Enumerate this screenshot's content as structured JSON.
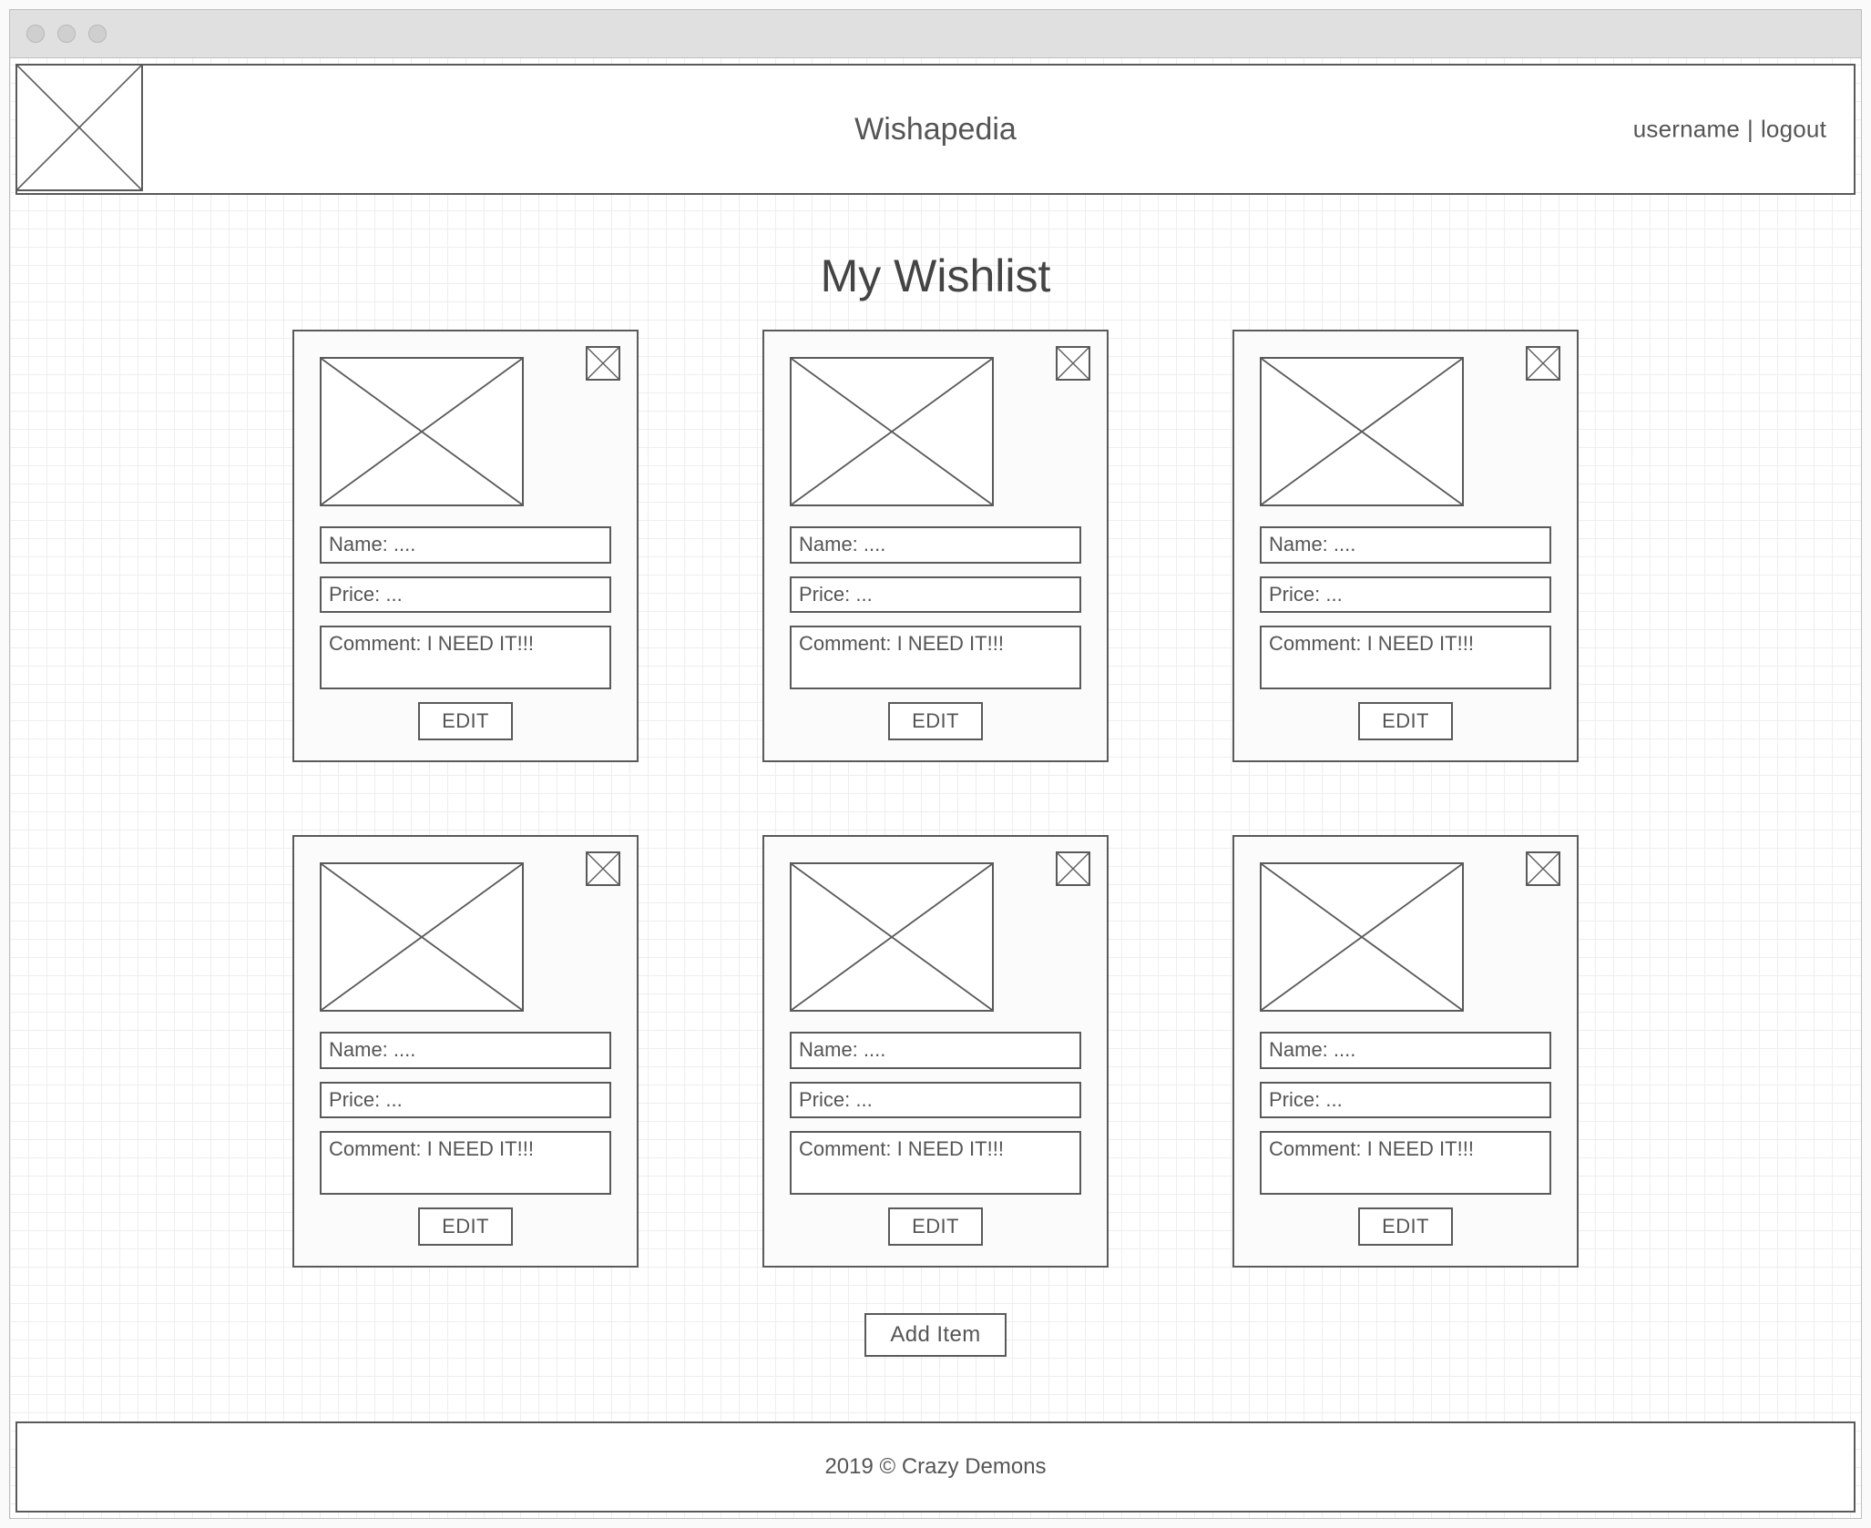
{
  "header": {
    "site_title": "Wishapedia",
    "user": {
      "name": "username",
      "logout": "logout",
      "sep": "|"
    }
  },
  "page": {
    "title": "My Wishlist",
    "add_button": "Add Item",
    "edit_button": "EDIT"
  },
  "items": [
    {
      "name": "Name: ....",
      "price": "Price: ...",
      "comment": "Comment: I NEED IT!!!"
    },
    {
      "name": "Name: ....",
      "price": "Price: ...",
      "comment": "Comment: I NEED IT!!!"
    },
    {
      "name": "Name: ....",
      "price": "Price: ...",
      "comment": "Comment: I NEED IT!!!"
    },
    {
      "name": "Name: ....",
      "price": "Price: ...",
      "comment": "Comment: I NEED IT!!!"
    },
    {
      "name": "Name: ....",
      "price": "Price: ...",
      "comment": "Comment: I NEED IT!!!"
    },
    {
      "name": "Name: ....",
      "price": "Price: ...",
      "comment": "Comment: I NEED IT!!!"
    }
  ],
  "footer": {
    "copyright": "2019 © Crazy Demons"
  }
}
